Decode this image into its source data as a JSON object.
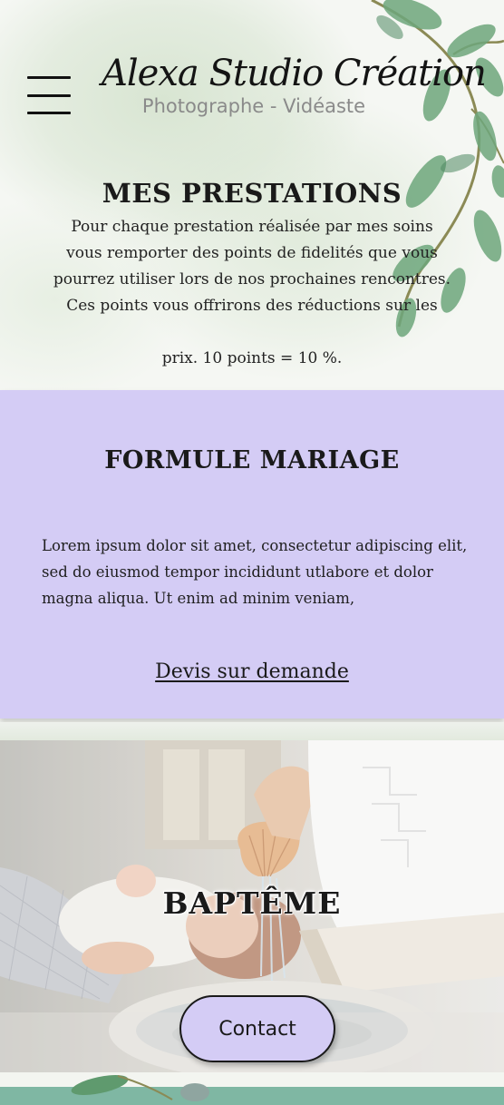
{
  "header": {
    "brand_title": "Alexa Studio Création",
    "brand_subtitle": "Photographe - Vidéaste",
    "menu_icon": "hamburger-menu-icon"
  },
  "prestations": {
    "title": "MES PRESTATIONS",
    "intro_lines": [
      "Pour chaque prestation réalisée par mes soins",
      "vous remporter des points de fidelités que vous",
      "pourrez utiliser lors de nos prochaines rencontres.",
      "Ces points vous offrirons des réductions sur les"
    ],
    "points_line": "prix.  10 points = 10 %."
  },
  "mariage": {
    "title": "FORMULE MARIAGE",
    "text": "Lorem ipsum dolor sit amet, consectetur adipiscing elit, sed do eiusmod tempor incididunt utlabore et dolor magna  aliqua. Ut enim ad minim veniam,",
    "devis_label": "Devis sur demande"
  },
  "bapteme": {
    "title": "BAPTÊME",
    "contact_label": "Contact"
  },
  "colors": {
    "accent_lavender": "#d4ccf5",
    "leaf_green": "#5f9a6e",
    "teal_band": "#7fb7a3"
  }
}
